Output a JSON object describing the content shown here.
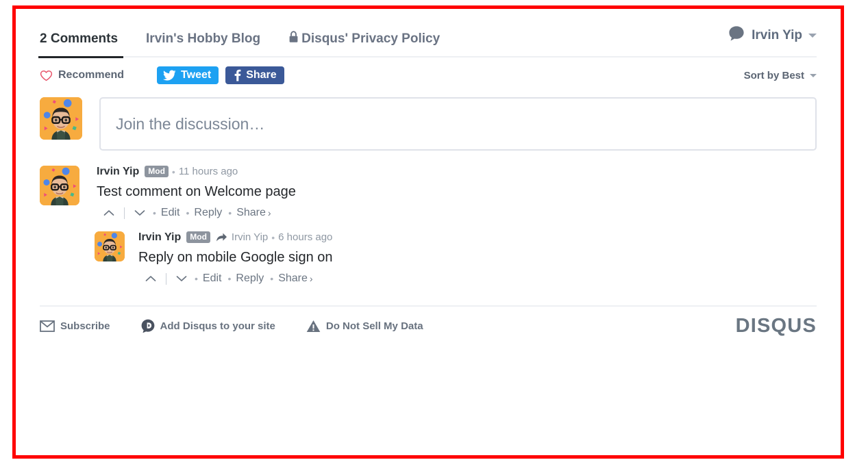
{
  "frame": {
    "accent_color": "#ff0000"
  },
  "header": {
    "tabs": [
      {
        "label": "2 Comments",
        "active": true,
        "icon": null
      },
      {
        "label": "Irvin's Hobby Blog",
        "active": false,
        "icon": null
      },
      {
        "label": "Disqus' Privacy Policy",
        "active": false,
        "icon": "lock-icon"
      }
    ],
    "user": {
      "name": "Irvin Yip",
      "icon": "speech-bubble-avatar-icon",
      "caret": "chevron-down-icon"
    }
  },
  "toolbar": {
    "recommend": {
      "label": "Recommend",
      "icon": "heart-icon",
      "color": "#e8566c"
    },
    "tweet": {
      "label": "Tweet",
      "icon": "twitter-bird-icon",
      "color": "#1da1f2"
    },
    "share": {
      "label": "Share",
      "icon": "facebook-f-icon",
      "color": "#3b5998"
    },
    "sort": {
      "label": "Sort by Best",
      "caret": "chevron-down-icon"
    }
  },
  "compose": {
    "placeholder": "Join the discussion…",
    "avatar": "user-avatar-memoji"
  },
  "comments": [
    {
      "author": "Irvin Yip",
      "badge": "Mod",
      "reply_to": null,
      "timestamp": "11 hours ago",
      "text": "Test comment on Welcome page",
      "actions": {
        "upvote": "chevron-up-icon",
        "downvote": "chevron-down-icon",
        "edit": "Edit",
        "reply": "Reply",
        "share": "Share",
        "share_caret": "›"
      }
    },
    {
      "author": "Irvin Yip",
      "badge": "Mod",
      "reply_to": "Irvin Yip",
      "reply_icon": "reply-arrow-icon",
      "timestamp": "6 hours ago",
      "text": "Reply on mobile Google sign on",
      "actions": {
        "upvote": "chevron-up-icon",
        "downvote": "chevron-down-icon",
        "edit": "Edit",
        "reply": "Reply",
        "share": "Share",
        "share_caret": "›"
      }
    }
  ],
  "footer": {
    "items": [
      {
        "label": "Subscribe",
        "icon": "envelope-icon"
      },
      {
        "label": "Add Disqus to your site",
        "icon": "disqus-d-icon"
      },
      {
        "label": "Do Not Sell My Data",
        "icon": "warning-triangle-icon"
      }
    ],
    "logo": "DISQUS"
  },
  "separators": {
    "dot": "•"
  }
}
